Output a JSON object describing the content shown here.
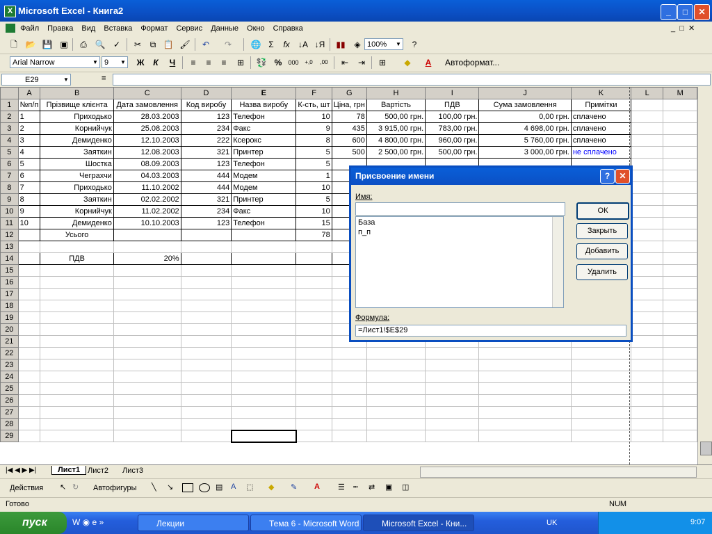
{
  "window": {
    "title": "Microsoft Excel - Книга2",
    "app_icon": "X"
  },
  "menu": [
    "Файл",
    "Правка",
    "Вид",
    "Вставка",
    "Формат",
    "Сервис",
    "Данные",
    "Окно",
    "Справка"
  ],
  "toolbar": {
    "zoom": "100%",
    "font": "Arial Narrow",
    "size": "9",
    "autoformat": "Автоформат...",
    "bold": "Ж",
    "italic": "К",
    "underline": "Ч"
  },
  "formula_bar": {
    "name_box": "E29",
    "equals": "="
  },
  "columns": [
    "A",
    "B",
    "C",
    "D",
    "E",
    "F",
    "G",
    "H",
    "I",
    "J",
    "K",
    "L",
    "M"
  ],
  "rows": [
    [
      "№п/п",
      "Прізвище клієнта",
      "Дата замовлення",
      "Код виробу",
      "Назва виробу",
      "К-сть, шт",
      "Ціна, грн",
      "Вартість",
      "ПДВ",
      "Сума замовлення",
      "Примітки",
      "",
      ""
    ],
    [
      "1",
      "Приходько",
      "28.03.2003",
      "123",
      "Телефон",
      "10",
      "78",
      "500,00 грн.",
      "100,00 грн.",
      "0,00 грн.",
      "сплачено",
      "",
      ""
    ],
    [
      "2",
      "Корнийчук",
      "25.08.2003",
      "234",
      "Факс",
      "9",
      "435",
      "3 915,00 грн.",
      "783,00 грн.",
      "4 698,00 грн.",
      "сплачено",
      "",
      ""
    ],
    [
      "3",
      "Демиденко",
      "12.10.2003",
      "222",
      "Ксерокс",
      "8",
      "600",
      "4 800,00 грн.",
      "960,00 грн.",
      "5 760,00 грн.",
      "сплачено",
      "",
      ""
    ],
    [
      "4",
      "Заяткин",
      "12.08.2003",
      "321",
      "Принтер",
      "5",
      "500",
      "2 500,00 грн.",
      "500,00 грн.",
      "3 000,00 грн.",
      "не сплачено",
      "",
      ""
    ],
    [
      "5",
      "Шостка",
      "08.09.2003",
      "123",
      "Телефон",
      "5",
      "",
      "",
      "",
      "",
      "",
      "",
      ""
    ],
    [
      "6",
      "Чеграхчи",
      "04.03.2003",
      "444",
      "Модем",
      "1",
      "",
      "",
      "",
      "",
      "",
      "",
      ""
    ],
    [
      "7",
      "Приходько",
      "11.10.2002",
      "444",
      "Модем",
      "10",
      "",
      "",
      "",
      "",
      "",
      "",
      ""
    ],
    [
      "8",
      "Заяткин",
      "02.02.2002",
      "321",
      "Принтер",
      "5",
      "",
      "",
      "",
      "",
      "",
      "",
      ""
    ],
    [
      "9",
      "Корнийчук",
      "11.02.2002",
      "234",
      "Факс",
      "10",
      "",
      "",
      "",
      "",
      "",
      "",
      ""
    ],
    [
      "10",
      "Демиденко",
      "10.10.2003",
      "123",
      "Телефон",
      "15",
      "",
      "",
      "",
      "",
      "",
      "",
      ""
    ],
    [
      "",
      "Усього",
      "",
      "",
      "",
      "78",
      "",
      "",
      "",
      "",
      "",
      "",
      ""
    ],
    [
      "",
      "",
      "",
      "",
      "",
      "",
      "",
      "",
      "",
      "",
      "",
      "",
      ""
    ],
    [
      "",
      "ПДВ",
      "20%",
      "",
      "",
      "",
      "",
      "",
      "",
      "",
      "",
      "",
      ""
    ]
  ],
  "total_rows": 29,
  "sheet_tabs": [
    "Лист1",
    "Лист2",
    "Лист3"
  ],
  "drawing": {
    "actions": "Действия",
    "autoshapes": "Автофигуры"
  },
  "status": {
    "ready": "Готово",
    "num": "NUM"
  },
  "dialog": {
    "title": "Присвоение имени",
    "name_label": "Имя:",
    "name_value": "",
    "names": [
      "База",
      "п_п"
    ],
    "formula_label": "Формула:",
    "formula_value": "=Лист1!$E$29",
    "buttons": {
      "ok": "ОК",
      "close": "Закрыть",
      "add": "Добавить",
      "delete": "Удалить"
    }
  },
  "taskbar": {
    "start": "пуск",
    "tasks": [
      "Лекции",
      "Тема 6 - Microsoft Word",
      "Microsoft Excel - Кни..."
    ],
    "lang": "UK",
    "clock": "9:07"
  }
}
